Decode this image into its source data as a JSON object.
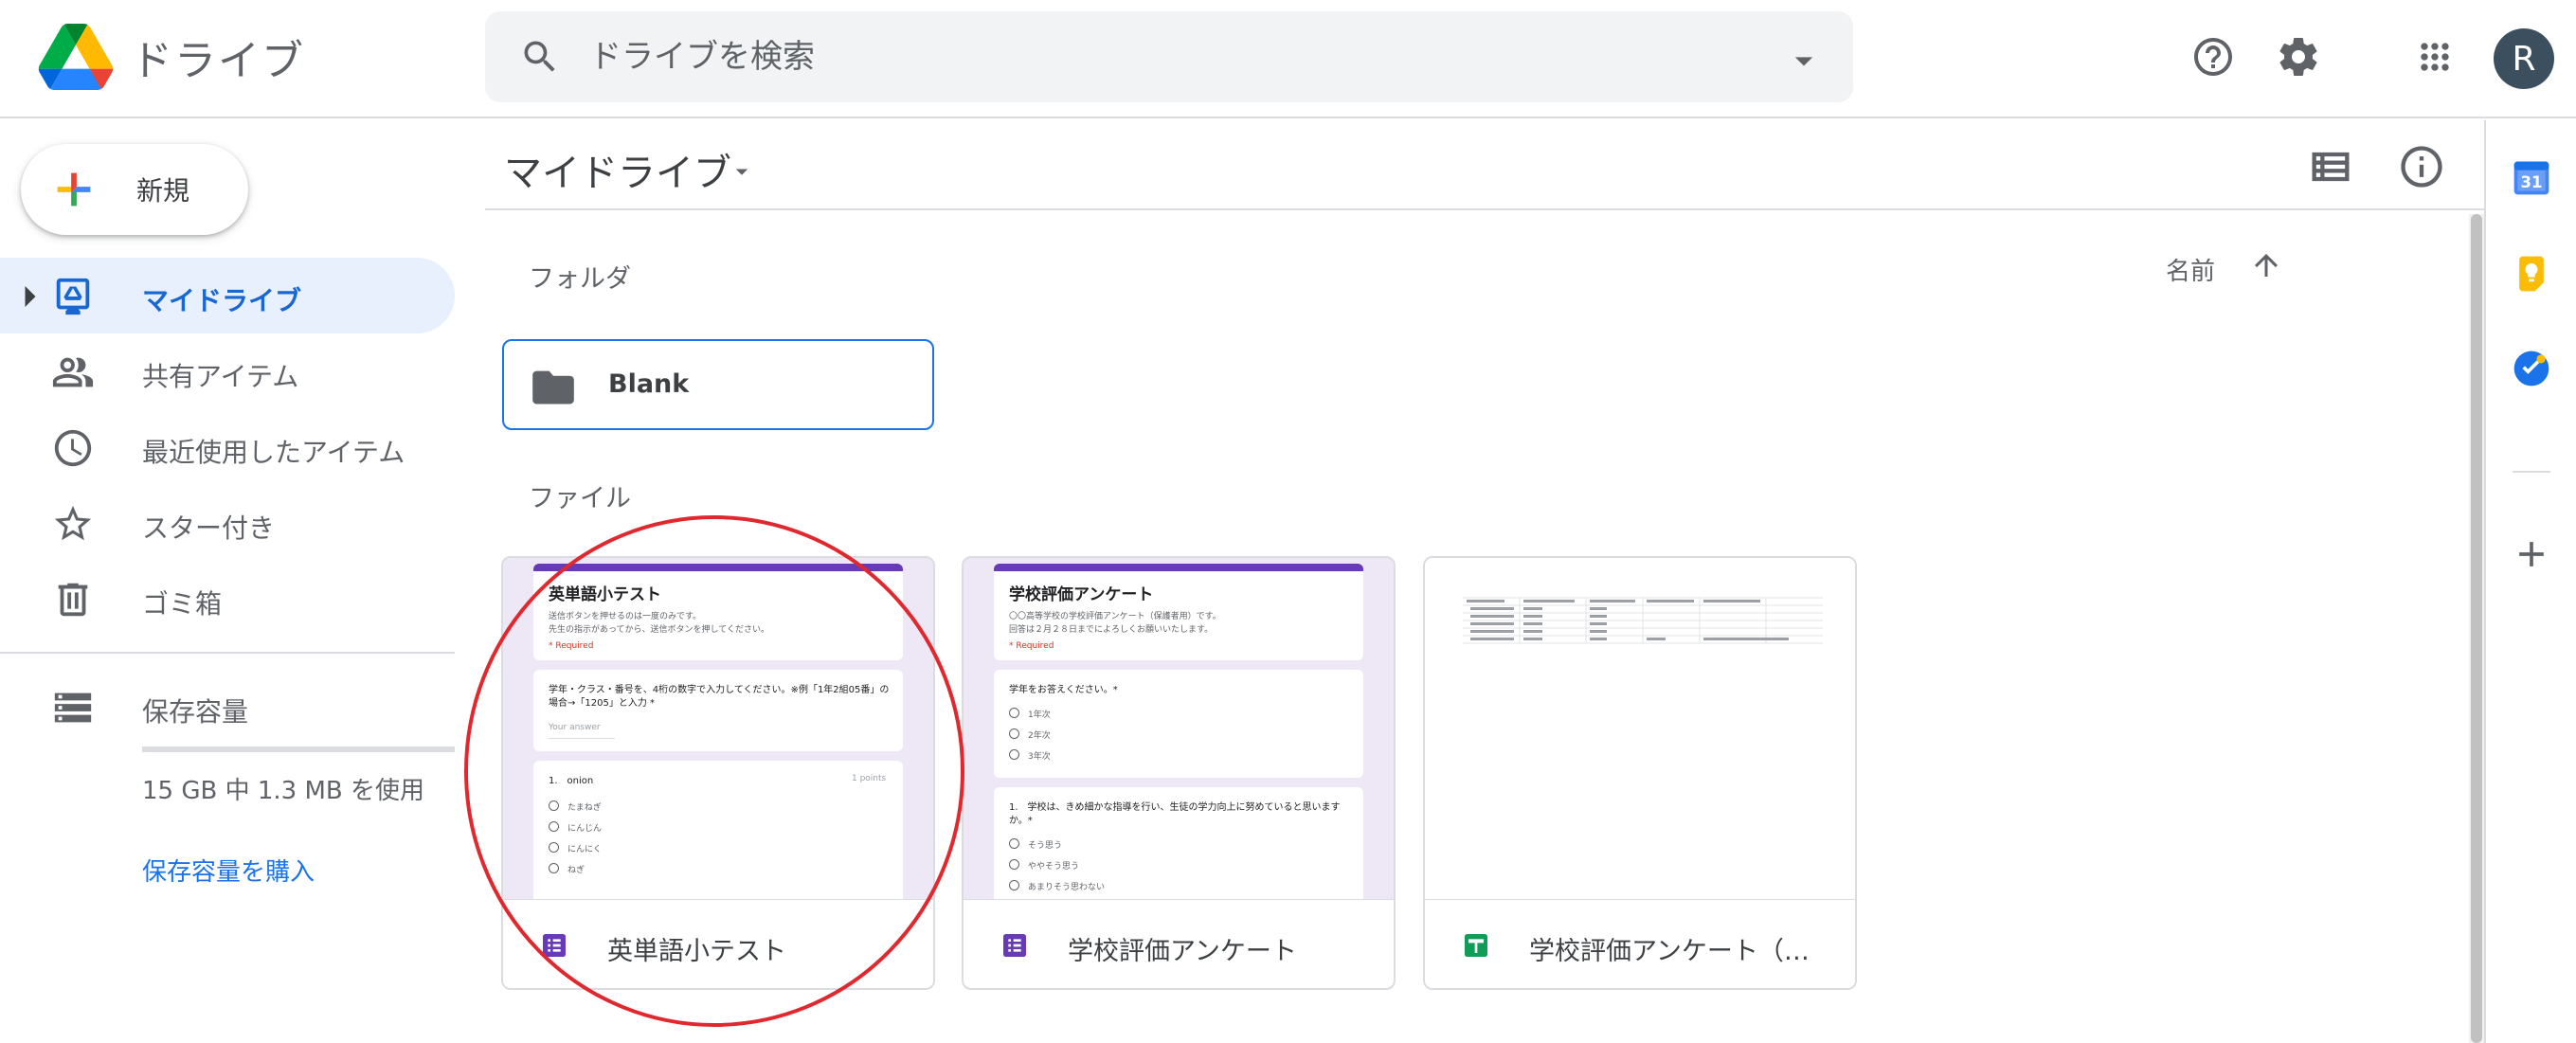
{
  "header": {
    "app_title": "ドライブ",
    "search_placeholder": "ドライブを検索",
    "avatar_letter": "R"
  },
  "nav": {
    "new_label": "新規",
    "items": [
      {
        "label": "マイドライブ",
        "icon": "my-drive-icon",
        "active": true
      },
      {
        "label": "共有アイテム",
        "icon": "people-icon"
      },
      {
        "label": "最近使用したアイテム",
        "icon": "clock-icon"
      },
      {
        "label": "スター付き",
        "icon": "star-icon"
      },
      {
        "label": "ゴミ箱",
        "icon": "trash-icon"
      }
    ],
    "storage_label": "保存容量",
    "storage_used_text": "15 GB 中 1.3 MB を使用",
    "storage_used_fraction": 0.0001,
    "buy_storage": "保存容量を購入"
  },
  "main": {
    "title": "マイドライブ",
    "folders_label": "フォルダ",
    "files_label": "ファイル",
    "sort_label": "名前",
    "folders": [
      {
        "name": "Blank"
      }
    ],
    "files": [
      {
        "name": "英単語小テスト",
        "type": "forms",
        "preview": {
          "title": "英単語小テスト",
          "desc1": "送信ボタンを押せるのは一度のみです。",
          "desc2": "先生の指示があってから、送信ボタンを押してください。",
          "required": "* Required",
          "q1": "学年・クラス・番号を、4桁の数字で入力してください。※例「1年2組05番」の",
          "q1b": "場合→「1205」と入力 *",
          "answer_placeholder": "Your answer",
          "q2": "1.　onion",
          "points": "1 points",
          "options": [
            "たまねぎ",
            "にんじん",
            "にんにく",
            "ねぎ"
          ]
        }
      },
      {
        "name": "学校評価アンケート",
        "type": "forms",
        "preview": {
          "title": "学校評価アンケート",
          "desc1": "〇〇高等学校の学校評価アンケート（保護者用）です。",
          "desc2": "回答は２月２８日までによろしくお願いいたします。",
          "required": "* Required",
          "q1": "学年をお答えください。*",
          "grades": [
            "1年次",
            "2年次",
            "3年次"
          ],
          "q2": "1.　学校は、きめ細かな指導を行い、生徒の学力向上に努めていると思います",
          "q2b": "か。*",
          "options": [
            "そう思う",
            "ややそう思う",
            "あまりそう思わない"
          ]
        }
      },
      {
        "name": "学校評価アンケート（回答）",
        "type": "sheets"
      }
    ]
  },
  "colors": {
    "accent": "#1a73e8",
    "active_bg": "#e8f0fe",
    "forms": "#673ab7",
    "sheets": "#0f9d58",
    "annotation": "#e0282e"
  }
}
